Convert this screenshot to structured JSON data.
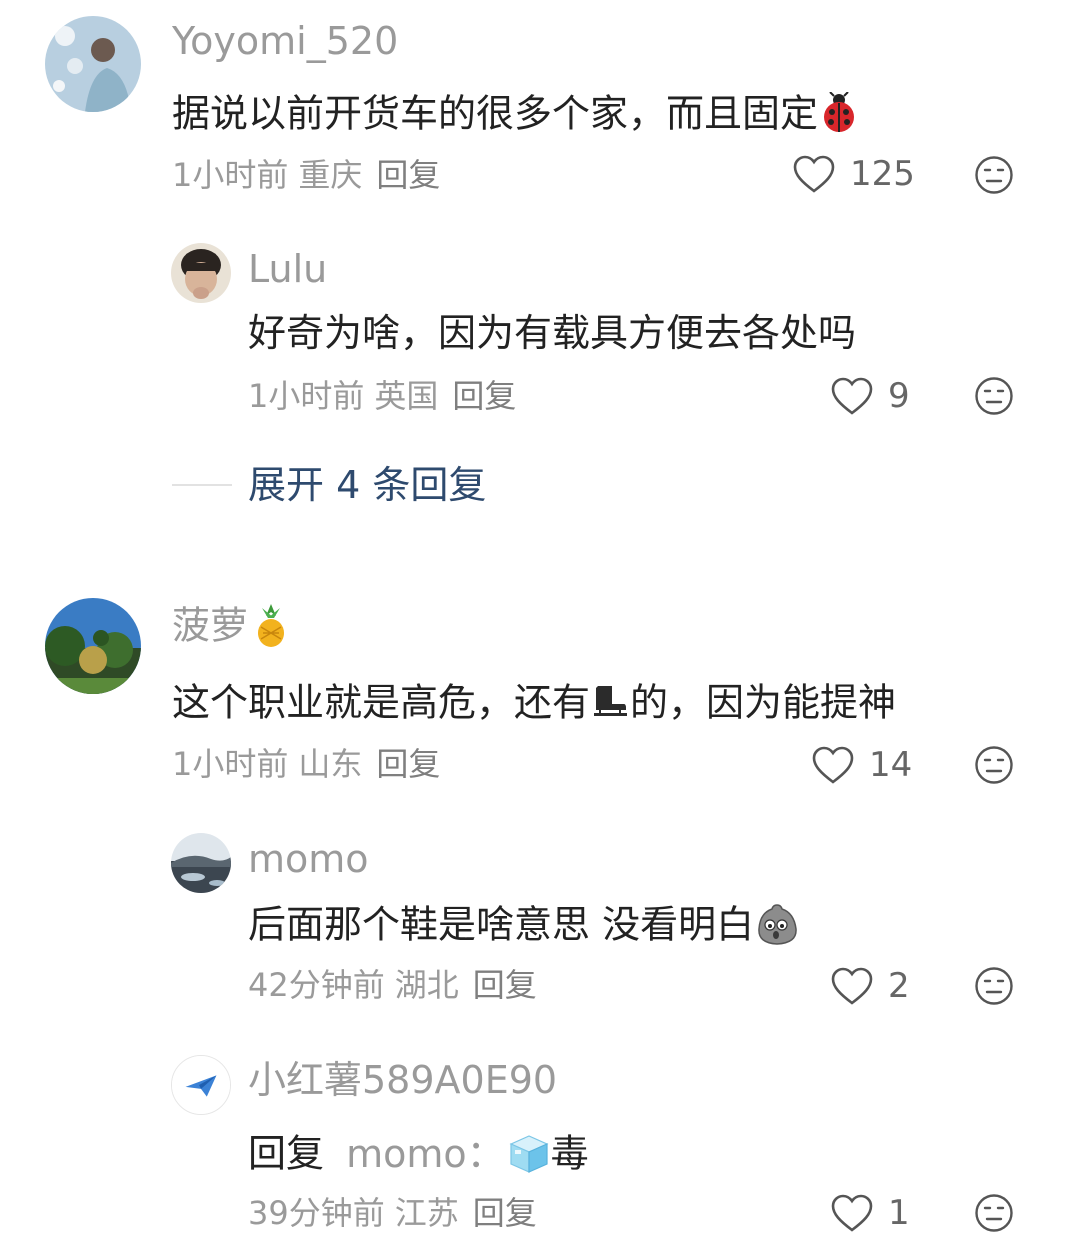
{
  "comments": [
    {
      "username": "Yoyomi_520",
      "text": "据说以前开货车的很多个家，而且固定",
      "emoji": "ladybug-emoji",
      "time": "1小时前",
      "location": "重庆",
      "reply_label": "回复",
      "likes": "125"
    },
    {
      "username": "Lulu",
      "text": "好奇为啥，因为有载具方便去各处吗",
      "time": "1小时前",
      "location": "英国",
      "reply_label": "回复",
      "likes": "9"
    },
    {
      "username": "菠萝",
      "username_emoji": "pineapple-emoji",
      "text_part1": "这个职业就是高危，还有",
      "text_part2": "的，因为能提神",
      "inline_emoji": "ice-skate-emoji",
      "time": "1小时前",
      "location": "山东",
      "reply_label": "回复",
      "likes": "14"
    },
    {
      "username": "momo",
      "text": "后面那个鞋是啥意思 没看明白",
      "emoji": "grey-blob-emoji",
      "time": "42分钟前",
      "location": "湖北",
      "reply_label": "回复",
      "likes": "2"
    },
    {
      "username": "小红薯589A0E90",
      "reply_prefix": "回复",
      "reply_target": "momo：",
      "emoji": "ice-cube-emoji",
      "text": "毒",
      "time": "39分钟前",
      "location": "江苏",
      "reply_label": "回复",
      "likes": "1"
    }
  ],
  "expand": {
    "label": "展开 4 条回复"
  },
  "icons": {
    "like": "heart-outline-icon",
    "dislike": "meh-face-icon"
  }
}
